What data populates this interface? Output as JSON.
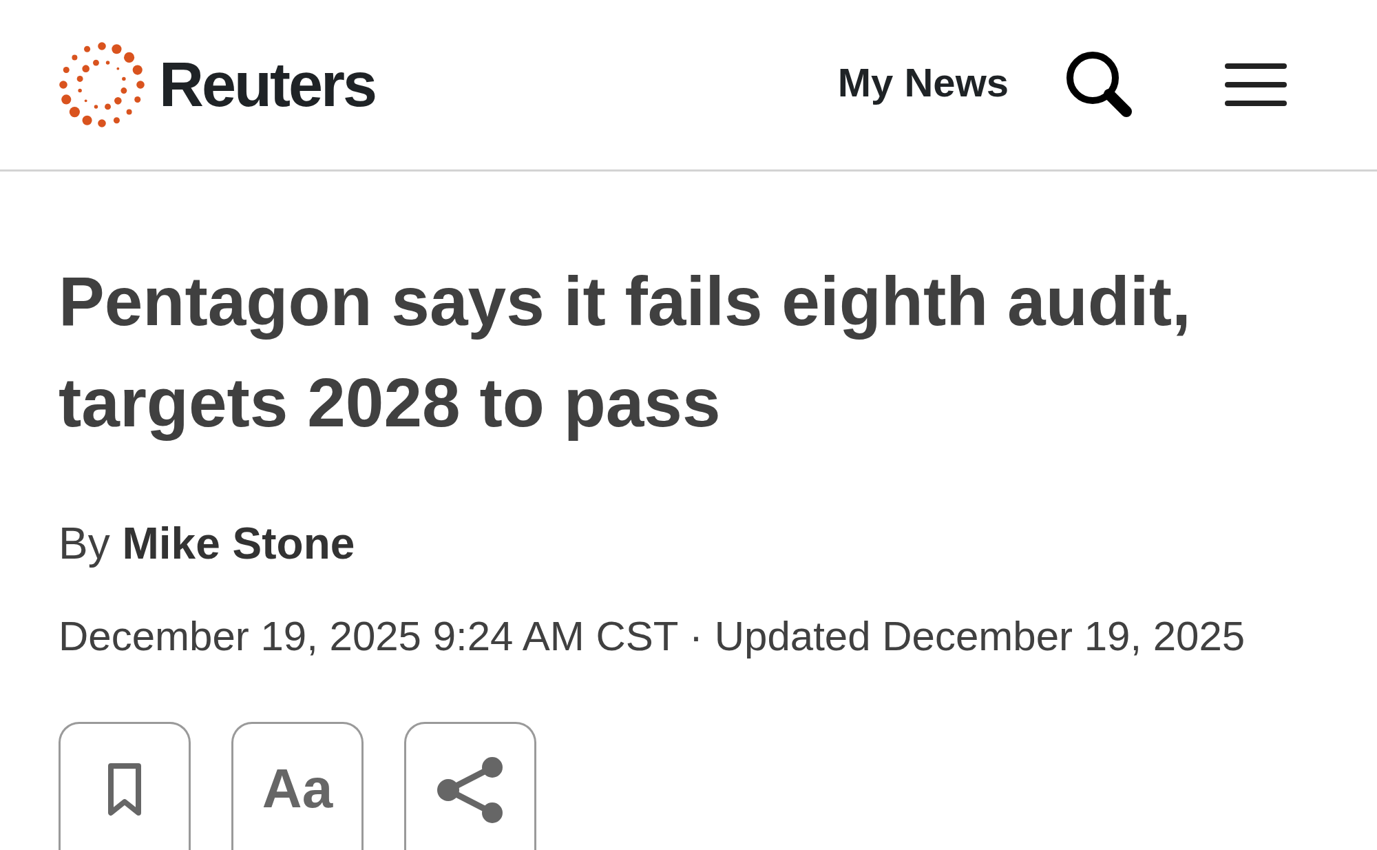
{
  "header": {
    "brand": "Reuters",
    "nav_link": "My News"
  },
  "article": {
    "headline": "Pentagon says it fails eighth audit, targets 2028 to pass",
    "byline": "By **Mike Stone**",
    "dateline": "December 19, 2025 9:24 AM CST · Updated December 19, 2025",
    "actions": [
      {
        "kind": "bookmark"
      },
      {
        "kind": "text_size",
        "label": "Aa"
      },
      {
        "kind": "share"
      }
    ]
  }
}
